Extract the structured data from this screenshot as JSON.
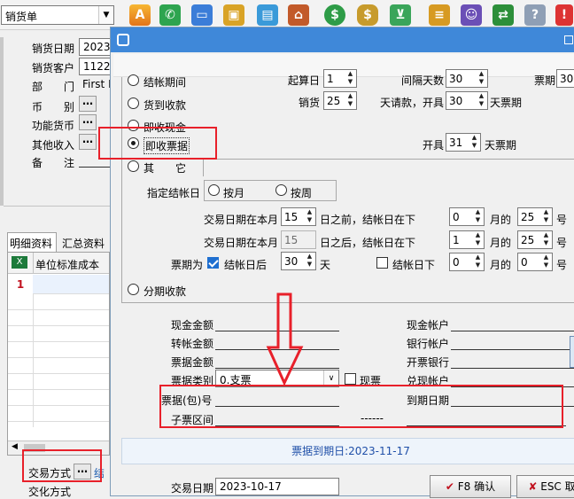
{
  "toolbar": {
    "doc_type": "销货单"
  },
  "left_form": {
    "sales_date_label": "销货日期",
    "sales_date_value": "2023",
    "customer_label": "销货客户",
    "customer_value": "1122",
    "dept_label": "部　　门",
    "dept_value": "First I",
    "currency_label": "币　　别",
    "func_currency_label": "功能货币",
    "other_income_label": "其他收入",
    "remark_label": "备　　注",
    "tabs": [
      "明细资料",
      "汇总资料"
    ],
    "grid_header": "单位标准成本",
    "grid_row_num": "1",
    "trade_method_label": "交易方式",
    "trade_method_value": "结",
    "cutoff_label": "交化方式"
  },
  "dialog": {
    "radio_labels": [
      "结帐期间",
      "货到收款",
      "即收现金",
      "即收票据",
      "其　　它",
      "分期收款"
    ],
    "selected_radio": 3,
    "start_day_label": "起算日",
    "start_day_value": "1",
    "interval_label": "间隔天数",
    "interval_value": "30",
    "bill_period_label": "票期",
    "bill_period_value": "30",
    "sales_label": "销货",
    "sales_value": "25",
    "days_request_label": "天请款，开具",
    "days_request_value": "30",
    "days_unit1": "天票期",
    "open_label": "开具",
    "open_value": "31",
    "days_unit2": "天票期",
    "settle_day_label": "指定结帐日",
    "by_month": "按月",
    "by_week": "按周",
    "row1_prefix": "交易日期在本月",
    "row1_day": "15",
    "row1_mid": "日之前，结帐日在下",
    "row1_month": "0",
    "row1_month_unit": "月的",
    "row1_day2": "25",
    "row1_day2_unit": "号",
    "row2_prefix": "交易日期在本月",
    "row2_day": "15",
    "row2_mid": "日之后，结帐日在下",
    "row2_month": "1",
    "row2_month_unit": "月的",
    "row2_day2": "25",
    "row2_day2_unit": "号",
    "period_label": "票期为",
    "after_settle_label": "结帐日后",
    "after_settle_value": "30",
    "after_settle_unit": "天",
    "settle_under_label": "结帐日下",
    "settle_under_month": "0",
    "settle_under_month_unit": "月的",
    "settle_under_day": "0",
    "settle_under_day_unit": "号",
    "fields": {
      "cash_amount": "现金金额",
      "transfer_amount": "转帐金额",
      "bill_amount": "票据金额",
      "bill_type": "票据类别",
      "bill_type_value": "0.支票",
      "current_bill": "现票",
      "bill_no": "票据(包)号",
      "sub_range": "子票区间",
      "range_dash": "------",
      "cash_account": "现金帐户",
      "bank_account": "银行帐户",
      "issuing_bank": "开票银行",
      "cashing_account": "兑现帐户",
      "due_date": "到期日期"
    },
    "due_date_status": "票据到期日:2023-11-17",
    "trade_date_label": "交易日期",
    "trade_date_value": "2023-10-17",
    "ok_button": "F8 确认",
    "esc_button": "ESC 取"
  }
}
